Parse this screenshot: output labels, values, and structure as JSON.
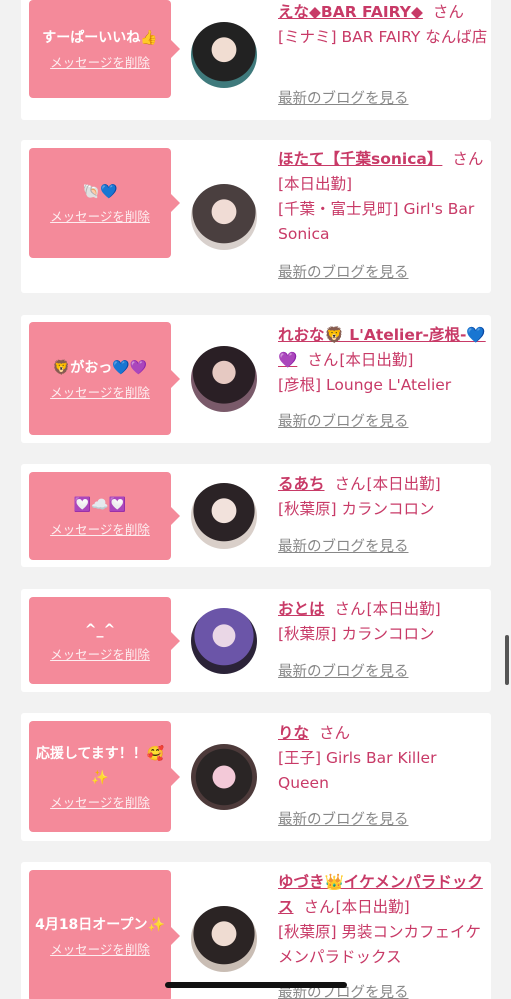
{
  "page": {
    "honorific": "さん",
    "delete_label": "メッセージを削除",
    "blog_label": "最新のブログを見る"
  },
  "colors": {
    "bubble": "#f48a9a",
    "accent": "#c83a67",
    "link_gray": "#888888",
    "background": "#f2f2f2"
  },
  "messages": [
    {
      "message": "すーぱーいいね👍",
      "name": "えな◆BAR FAIRY◆",
      "shift": "",
      "shop": "[ミナミ] BAR FAIRY なんば店"
    },
    {
      "message": "🐚💙",
      "name": "ほたて【千葉sonica】",
      "shift": "[本日出勤]",
      "shop": "[千葉・富士見町] Girl's Bar Sonica"
    },
    {
      "message": "🦁がおっ💙💜",
      "name": "れおな🦁 L'Atelier-彦根-💙💜",
      "shift": "[本日出勤]",
      "shop": "[彦根] Lounge L'Atelier"
    },
    {
      "message": "💟☁️💟",
      "name": "るあち",
      "shift": "[本日出勤]",
      "shop": "[秋葉原] カランコロン"
    },
    {
      "message": "^_^",
      "name": "おとは",
      "shift": "[本日出勤]",
      "shop": "[秋葉原] カランコロン"
    },
    {
      "message": "応援してます！！🥰✨",
      "name": "りな",
      "shift": "",
      "shop": "[王子] Girls Bar Killer Queen"
    },
    {
      "message": "4月18日オープン✨",
      "name": "ゆづき👑イケメンパラドックス",
      "shift": "[本日出勤]",
      "shop": "[秋葉原] 男装コンカフェイケメンパラドックス"
    }
  ]
}
